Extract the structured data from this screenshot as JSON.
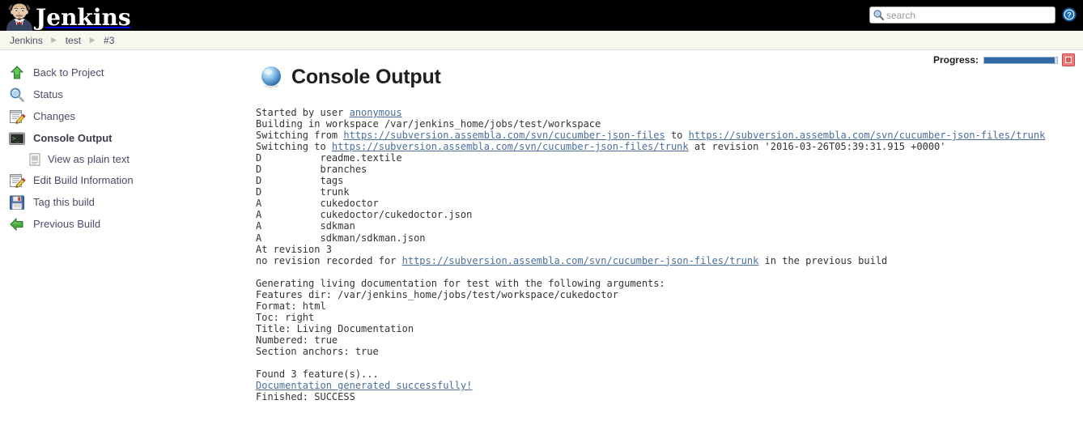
{
  "header": {
    "brand": "Jenkins",
    "logo_icon": "jenkins-butler-logo",
    "search": {
      "placeholder": "search",
      "value": "",
      "icon": "search-icon"
    },
    "help_icon": "help-circle-icon"
  },
  "breadcrumb": {
    "items": [
      {
        "label": "Jenkins"
      },
      {
        "label": "test"
      },
      {
        "label": "#3"
      }
    ],
    "separator": "▶"
  },
  "sidebar": {
    "items": [
      {
        "label": "Back to Project",
        "icon": "up-arrow-icon",
        "current": false,
        "sub": false
      },
      {
        "label": "Status",
        "icon": "magnifier-icon",
        "current": false,
        "sub": false
      },
      {
        "label": "Changes",
        "icon": "notepad-pencil-icon",
        "current": false,
        "sub": false
      },
      {
        "label": "Console Output",
        "icon": "terminal-icon",
        "current": true,
        "sub": false
      },
      {
        "label": "View as plain text",
        "icon": "document-icon",
        "current": false,
        "sub": true
      },
      {
        "label": "Edit Build Information",
        "icon": "notepad-pencil-icon",
        "current": false,
        "sub": false
      },
      {
        "label": "Tag this build",
        "icon": "floppy-disk-icon",
        "current": false,
        "sub": false
      },
      {
        "label": "Previous Build",
        "icon": "left-arrow-icon",
        "current": false,
        "sub": false
      }
    ]
  },
  "main": {
    "title": "Console Output",
    "title_icon": "blue-build-ball-icon",
    "progress": {
      "label": "Progress:",
      "percent": 97,
      "stop_icon": "stop-build-icon"
    }
  },
  "console": {
    "lines": [
      {
        "segments": [
          {
            "t": "Started by user "
          },
          {
            "t": "anonymous",
            "link": true
          }
        ]
      },
      {
        "segments": [
          {
            "t": "Building in workspace /var/jenkins_home/jobs/test/workspace"
          }
        ]
      },
      {
        "segments": [
          {
            "t": "Switching from "
          },
          {
            "t": "https://subversion.assembla.com/svn/cucumber-json-files",
            "link": true
          },
          {
            "t": " to "
          },
          {
            "t": "https://subversion.assembla.com/svn/cucumber-json-files/trunk",
            "link": true
          }
        ]
      },
      {
        "segments": [
          {
            "t": "Switching to "
          },
          {
            "t": "https://subversion.assembla.com/svn/cucumber-json-files/trunk",
            "link": true
          },
          {
            "t": " at revision '2016-03-26T05:39:31.915 +0000'"
          }
        ]
      },
      {
        "segments": [
          {
            "t": "D          readme.textile"
          }
        ]
      },
      {
        "segments": [
          {
            "t": "D          branches"
          }
        ]
      },
      {
        "segments": [
          {
            "t": "D          tags"
          }
        ]
      },
      {
        "segments": [
          {
            "t": "D          trunk"
          }
        ]
      },
      {
        "segments": [
          {
            "t": "A          cukedoctor"
          }
        ]
      },
      {
        "segments": [
          {
            "t": "A          cukedoctor/cukedoctor.json"
          }
        ]
      },
      {
        "segments": [
          {
            "t": "A          sdkman"
          }
        ]
      },
      {
        "segments": [
          {
            "t": "A          sdkman/sdkman.json"
          }
        ]
      },
      {
        "segments": [
          {
            "t": "At revision 3"
          }
        ]
      },
      {
        "segments": [
          {
            "t": "no revision recorded for "
          },
          {
            "t": "https://subversion.assembla.com/svn/cucumber-json-files/trunk",
            "link": true
          },
          {
            "t": " in the previous build"
          }
        ]
      },
      {
        "segments": [
          {
            "t": ""
          }
        ]
      },
      {
        "segments": [
          {
            "t": "Generating living documentation for test with the following arguments:"
          }
        ]
      },
      {
        "segments": [
          {
            "t": "Features dir: /var/jenkins_home/jobs/test/workspace/cukedoctor"
          }
        ]
      },
      {
        "segments": [
          {
            "t": "Format: html"
          }
        ]
      },
      {
        "segments": [
          {
            "t": "Toc: right"
          }
        ]
      },
      {
        "segments": [
          {
            "t": "Title: Living Documentation"
          }
        ]
      },
      {
        "segments": [
          {
            "t": "Numbered: true"
          }
        ]
      },
      {
        "segments": [
          {
            "t": "Section anchors: true"
          }
        ]
      },
      {
        "segments": [
          {
            "t": ""
          }
        ]
      },
      {
        "segments": [
          {
            "t": "Found 3 feature(s)..."
          }
        ]
      },
      {
        "segments": [
          {
            "t": "Documentation generated successfully!",
            "link": true
          }
        ]
      },
      {
        "segments": [
          {
            "t": "Finished: SUCCESS"
          }
        ]
      }
    ]
  }
}
